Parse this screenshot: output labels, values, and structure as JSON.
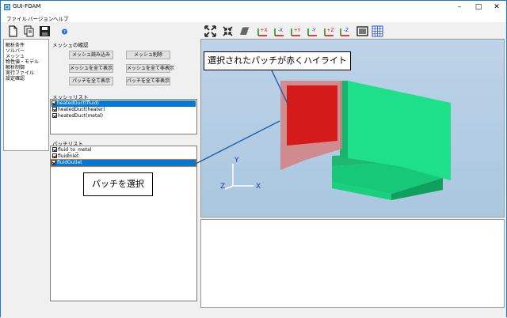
{
  "app": {
    "title": "GUI-FOAM"
  },
  "menu": {
    "items": [
      "ファイル",
      "バージョン",
      "ヘルプ"
    ]
  },
  "tree": {
    "items": [
      "解析条件",
      "ソルバー",
      "メッシュ",
      "物性値・モデル",
      "解析制御",
      "実行ファイル",
      "設定確認"
    ]
  },
  "mesh_check": {
    "label": "メッシュの確認",
    "buttons": {
      "load": "メッシュ読み込み",
      "delete": "メッシュ削除",
      "show_all_mesh": "メッシュを全て表示",
      "hide_all_mesh": "メッシュを全て非表示",
      "show_all_patch": "パッチを全て表示",
      "hide_all_patch": "パッチを全て非表示"
    }
  },
  "mesh_list": {
    "label": "メッシュリスト",
    "items": [
      {
        "label": "heatedDuct(fluid)",
        "checked": true,
        "selected": true
      },
      {
        "label": "heatedDuct(heater)",
        "checked": true,
        "selected": false
      },
      {
        "label": "heatedDuct(metal)",
        "checked": true,
        "selected": false
      }
    ]
  },
  "patch_list": {
    "label": "パッチリスト",
    "items": [
      {
        "label": "fluid_to_metal",
        "checked": true,
        "selected": false
      },
      {
        "label": "fluidInlet",
        "checked": true,
        "selected": false
      },
      {
        "label": "fluidOutlet",
        "checked": true,
        "selected": true
      }
    ]
  },
  "viewport": {
    "axes": {
      "x": "X",
      "y": "Y",
      "z": "Z"
    }
  },
  "callouts": {
    "highlight": "選択されたパッチが赤くハイライト",
    "select": "パッチを選択"
  },
  "toolbar": {
    "icons": [
      "new-file-icon",
      "copy-icon",
      "save-icon",
      "help-icon",
      "fit-icon",
      "zoom-fit-icon",
      "shape-icon",
      "view-plus-x-icon",
      "view-minus-x-icon",
      "view-plus-y-icon",
      "view-minus-y-icon",
      "view-plus-z-icon",
      "view-minus-z-icon",
      "screen-icon",
      "grid-icon"
    ],
    "axis_labels": [
      "+X",
      "-X",
      "+Y",
      "-Y",
      "+Z",
      "-Z"
    ]
  },
  "colors": {
    "highlight": "#d41a1a",
    "mesh_green": "#1fe08a",
    "selection": "#0078d7",
    "callout_line": "#1f5fa8"
  }
}
